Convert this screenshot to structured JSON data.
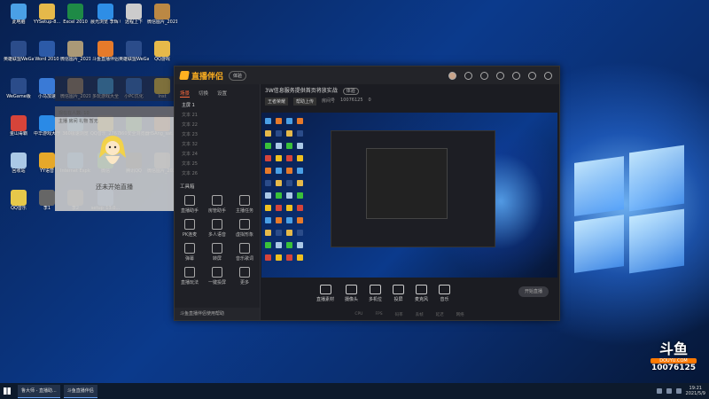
{
  "desktop": {
    "icons": [
      {
        "label": "此电脑",
        "color": "#4aa0e6"
      },
      {
        "label": "YYSetup-8...",
        "color": "#e6b94a"
      },
      {
        "label": "Excel 2010",
        "color": "#1e8a46"
      },
      {
        "label": "晨光浏览 李辉 敬爱",
        "color": "#2e8ee6"
      },
      {
        "label": "远程上下",
        "color": "#cccccc"
      },
      {
        "label": "微信图片_2021010...",
        "color": "#bb8844"
      },
      {
        "label": "英雄联盟WeGame版",
        "color": "#2b4c8a"
      },
      {
        "label": "Word 2010",
        "color": "#2c5aa8"
      },
      {
        "label": "微信图片_2021010...",
        "color": "#aa9977"
      },
      {
        "label": "斗鱼直播伴侣",
        "color": "#e67a2a"
      },
      {
        "label": "英雄联盟WeGame版",
        "color": "#2b4c8a"
      },
      {
        "label": "QQ游戏",
        "color": "#e6b94a"
      },
      {
        "label": "WeGame版",
        "color": "#2b4c8a"
      },
      {
        "label": "小马加速",
        "color": "#3a7ad6"
      },
      {
        "label": "微信图片_2021010...",
        "color": "#998877"
      },
      {
        "label": "多玩游戏大全",
        "color": "#3aa0e6"
      },
      {
        "label": "小PC优化",
        "color": "#2a70d0"
      },
      {
        "label": "Inst",
        "color": "#e6c84a"
      },
      {
        "label": "金山毒霸",
        "color": "#d6443a"
      },
      {
        "label": "中华游戏大厅",
        "color": "#2a8ae6"
      },
      {
        "label": "360极速浏览",
        "color": "#3a9ae6"
      },
      {
        "label": "QQ音乐_276761860",
        "color": "#f0c020"
      },
      {
        "label": "360安全浏览器",
        "color": "#4ab04a"
      },
      {
        "label": "HSAng_sat...",
        "color": "#cc6622"
      },
      {
        "label": "回收站",
        "color": "#aac8e6"
      },
      {
        "label": "YY语音",
        "color": "#e6a82a"
      },
      {
        "label": "Internet Explorer",
        "color": "#2a8ae6"
      },
      {
        "label": "微信",
        "color": "#3ac03a"
      },
      {
        "label": "腾讯QQ",
        "color": "#2a2a2a"
      },
      {
        "label": "微信图片_2021010...",
        "color": "#888888"
      },
      {
        "label": "QQ音乐",
        "color": "#e6c84a"
      },
      {
        "label": "李1",
        "color": "#666666"
      },
      {
        "label": "李2",
        "color": "#777777"
      },
      {
        "label": "setup_13.0...",
        "color": "#4a8ae6"
      }
    ]
  },
  "app": {
    "logo_text": "直播伴侣",
    "version_badge": "体验",
    "sidebar": {
      "tabs": [
        "场景",
        "切换",
        "设置"
      ],
      "scenes": [
        "主屏 1",
        "文本 21",
        "文本 22",
        "文本 23",
        "文本 32",
        "文本 24",
        "文本 25",
        "文本 26"
      ],
      "tools_title": "工具箱",
      "tools": [
        "直播助手",
        "房管助手",
        "主播任务",
        "PK连麦",
        "多人语音",
        "虚拟形象",
        "弹幕",
        "转屏",
        "音乐歌词",
        "直播玩法",
        "一键投屏",
        "更多"
      ],
      "bottom_text": "斗鱼直播伴侣使用帮助"
    },
    "room": {
      "title": "3W信息服务提供首页将放实战",
      "badge": "体验",
      "category": "王者荣耀",
      "sub": "帮助上传",
      "room_label": "房间号",
      "room_id": "10076125",
      "fans": "0"
    },
    "bottom_tools": [
      "直播素材",
      "摄像头",
      "多机位",
      "投屏",
      "麦克风",
      "音乐"
    ],
    "start_button": "开始直播",
    "stats": [
      "CPU",
      "FPS",
      "码率",
      "丢帧",
      "延迟",
      "网络"
    ]
  },
  "float_panel": {
    "line1": "现在在人数: 10",
    "line2": "主播 房间 礼物 暂无",
    "caption": "还未开始直播"
  },
  "watermark": {
    "brand": "斗鱼",
    "sub": "DOUYU.COM",
    "room": "10076125"
  },
  "taskbar": {
    "items": [
      "鲁大师 - 直播助...",
      "斗鱼直播伴侣"
    ],
    "time": "19:21",
    "date": "2021/5/9"
  }
}
